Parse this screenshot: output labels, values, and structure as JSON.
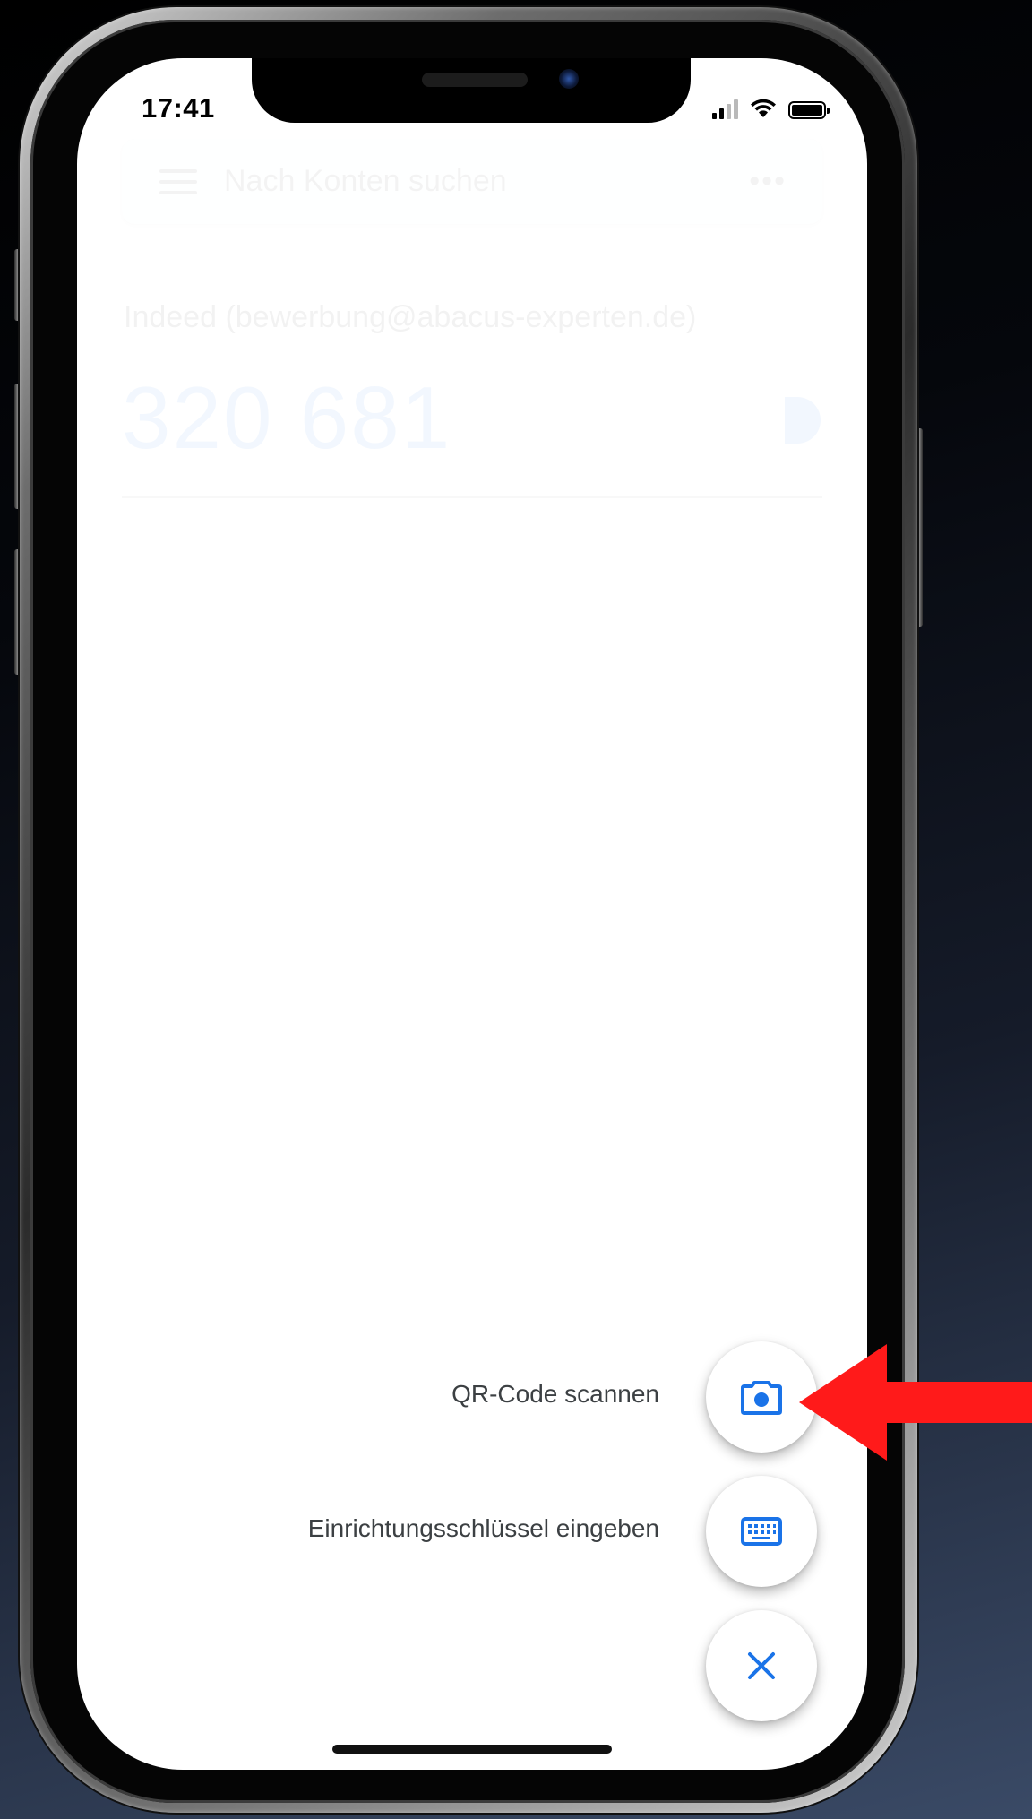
{
  "status_bar": {
    "time": "17:41",
    "icons": [
      "cellular-signal-icon",
      "wifi-icon",
      "battery-icon"
    ]
  },
  "search": {
    "placeholder": "Nach Konten suchen",
    "menu_icon": "hamburger-menu-icon",
    "more_icon": "more-dots-icon",
    "more_label": "•••"
  },
  "account": {
    "name": "Indeed (bewerbung@abacus-experten.de)",
    "code": "320 681",
    "timer_icon": "countdown-timer-icon"
  },
  "fab_menu": {
    "scan_qr_label": "QR-Code scannen",
    "scan_qr_icon": "camera-icon",
    "enter_key_label": "Einrichtungsschlüssel eingeben",
    "enter_key_icon": "keyboard-icon",
    "close_icon": "close-icon"
  },
  "colors": {
    "accent": "#1a73e8",
    "annotation_arrow": "#ff1a1a",
    "label_text": "#3c4043"
  }
}
